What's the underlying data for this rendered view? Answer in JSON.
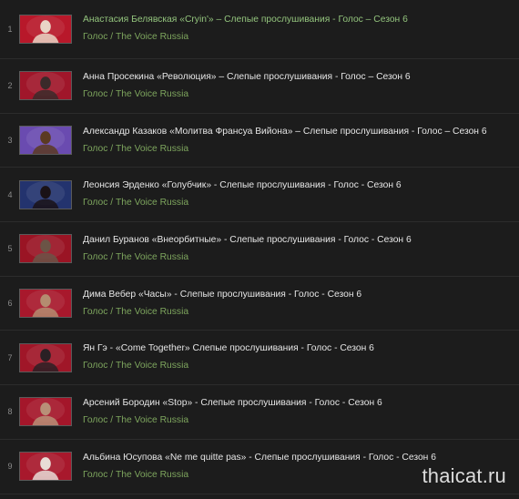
{
  "playlist": {
    "items": [
      {
        "index": "1",
        "title": "Анастасия Белявская «Cryin'» – Слепые прослушивания - Голос – Сезон 6",
        "author": "Голос / The Voice Russia",
        "thumb_bg": "#b8182a",
        "thumb_fg": "#e9d6c6"
      },
      {
        "index": "2",
        "title": "Анна Просекина «Революция» – Слепые прослушивания - Голос – Сезон 6",
        "author": "Голос / The Voice Russia",
        "thumb_bg": "#a0162a",
        "thumb_fg": "#3a2a2a"
      },
      {
        "index": "3",
        "title": "Александр Казаков «Молитва Франсуа Вийона» – Слепые прослушивания - Голос – Сезон 6",
        "author": "Голос / The Voice Russia",
        "thumb_bg": "#6a4bb0",
        "thumb_fg": "#5b3a22"
      },
      {
        "index": "4",
        "title": "Леонсия Эрденко «Голубчик» - Слепые прослушивания - Голос - Сезон 6",
        "author": "Голос / The Voice Russia",
        "thumb_bg": "#23336e",
        "thumb_fg": "#1a1216"
      },
      {
        "index": "5",
        "title": "Данил Буранов «Внеорбитные» - Слепые прослушивания - Голос - Сезон 6",
        "author": "Голос / The Voice Russia",
        "thumb_bg": "#9a1424",
        "thumb_fg": "#6b5446"
      },
      {
        "index": "6",
        "title": "Дима Вебер «Часы» - Слепые прослушивания - Голос - Сезон 6",
        "author": "Голос / The Voice Russia",
        "thumb_bg": "#a8182c",
        "thumb_fg": "#b48c70"
      },
      {
        "index": "7",
        "title": "Ян Гэ - «Come Together» Слепые прослушивания - Голос - Сезон 6",
        "author": "Голос / The Voice Russia",
        "thumb_bg": "#a01628",
        "thumb_fg": "#2a2024"
      },
      {
        "index": "8",
        "title": "Арсений Бородин «Stop» - Слепые прослушивания - Голос - Сезон 6",
        "author": "Голос / The Voice Russia",
        "thumb_bg": "#a4162a",
        "thumb_fg": "#b89078"
      },
      {
        "index": "9",
        "title": "Альбина Юсупова «Ne me quitte pas» - Слепые прослушивания - Голос - Сезон 6",
        "author": "Голос / The Voice Russia",
        "thumb_bg": "#a8182c",
        "thumb_fg": "#e8dcd6"
      }
    ]
  },
  "watermark": "thaicat.ru"
}
